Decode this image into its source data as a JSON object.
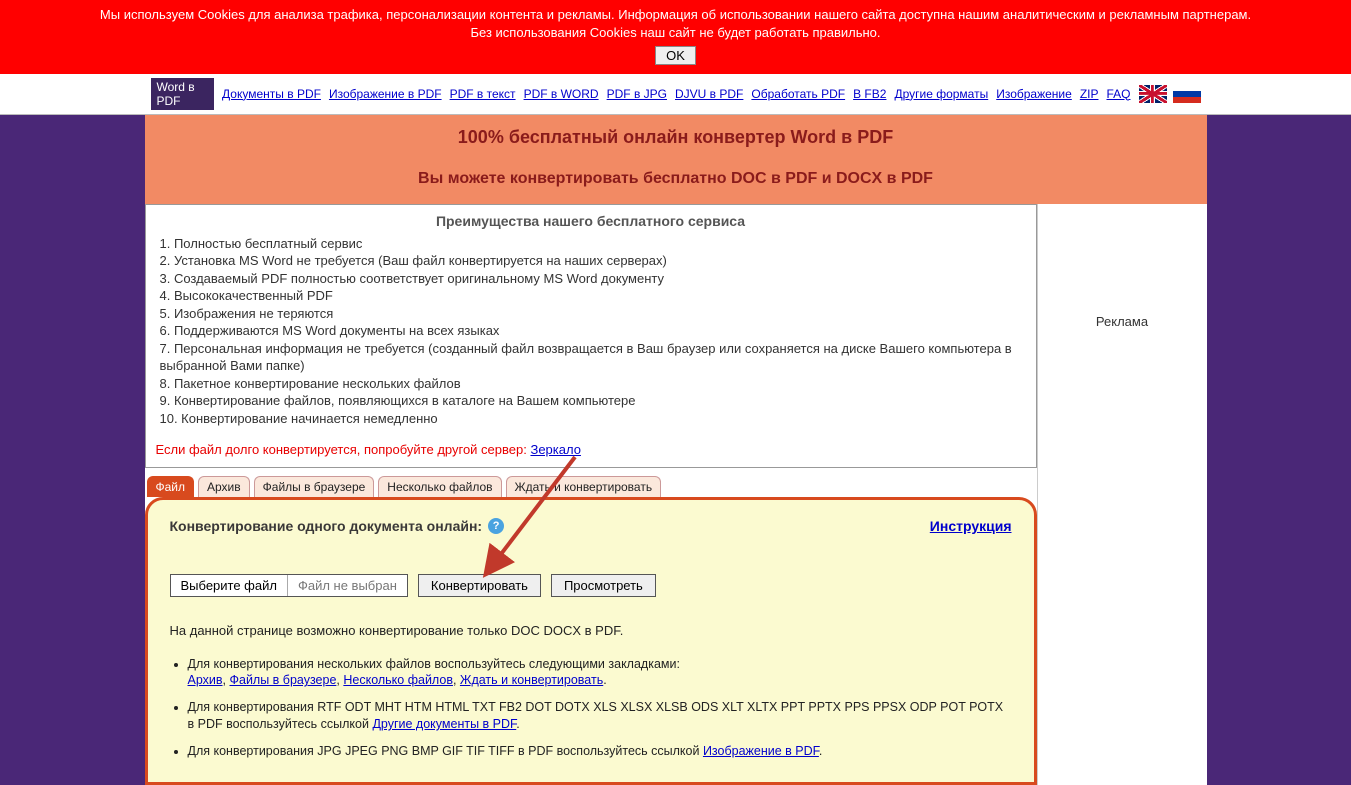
{
  "cookie": {
    "line1": "Мы используем Cookies для анализа трафика, персонализации контента и рекламы. Информация об использовании нашего сайта доступна нашим аналитическим и рекламным партнерам.",
    "line2": "Без использования Cookies наш сайт не будет работать правильно.",
    "ok": "OK"
  },
  "nav": {
    "active": "Word в PDF",
    "items": [
      "Документы в PDF",
      "Изображение в PDF",
      "PDF в текст",
      "PDF в WORD",
      "PDF в JPG",
      "DJVU в PDF",
      "Обработать PDF",
      "В FB2",
      "Другие форматы",
      "Изображение",
      "ZIP",
      "FAQ"
    ]
  },
  "hero": {
    "h1": "100% бесплатный онлайн конвертер Word в PDF",
    "h2": "Вы можете конвертировать бесплатно DOC в PDF и DOCX в PDF"
  },
  "benefits": {
    "title": "Преимущества нашего бесплатного сервиса",
    "items": [
      "1. Полностью бесплатный сервис",
      "2. Установка MS Word не требуется (Ваш файл конвертируется на наших серверах)",
      "3. Создаваемый PDF полностью соответствует оригинальному MS Word документу",
      "4. Высококачественный PDF",
      "5. Изображения не теряются",
      "6. Поддерживаются MS Word документы на всех языках",
      "7. Персональная информация не требуется (созданный файл возвращается в Ваш браузер или сохраняется на диске Вашего компьютера в выбранной Вами папке)",
      "8. Пакетное конвертирование нескольких файлов",
      "9. Конвертирование файлов, появляющихся в каталоге на Вашем компьютере",
      "10. Конвертирование начинается немедленно"
    ],
    "mirror_prefix": "Если файл долго конвертируется, попробуйте другой сервер: ",
    "mirror_link": "Зеркало"
  },
  "ad_label": "Реклама",
  "tabs": [
    "Файл",
    "Архив",
    "Файлы в браузере",
    "Несколько файлов",
    "Ждать и конвертировать"
  ],
  "panel": {
    "title": "Конвертирование одного документа онлайн:",
    "instruction": "Инструкция",
    "choose": "Выберите файл",
    "nofile": "Файл не выбран",
    "convert": "Конвертировать",
    "view": "Просмотреть",
    "note": "На данной странице возможно конвертирование только DOC DOCX в PDF.",
    "b1_text": "Для конвертирования нескольких файлов воспользуйтесь следующими закладками:",
    "b1_links": [
      "Архив",
      "Файлы в браузере",
      "Несколько файлов",
      "Ждать и конвертировать"
    ],
    "b2_text": "Для конвертирования RTF ODT MHT HTM HTML TXT FB2 DOT DOTX XLS XLSX XLSB ODS XLT XLTX PPT PPTX PPS PPSX ODP POT POTX в PDF воспользуйтесь ссылкой ",
    "b2_link": "Другие документы в PDF",
    "b3_text": "Для конвертирования JPG JPEG PNG BMP GIF TIF TIFF в PDF воспользуйтесь ссылкой ",
    "b3_link": "Изображение в PDF"
  }
}
